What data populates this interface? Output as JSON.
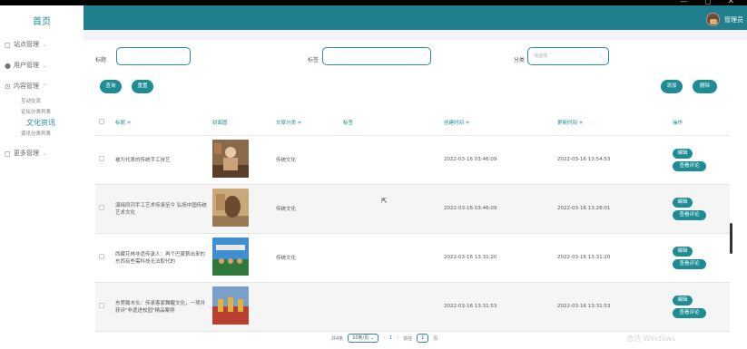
{
  "window": {
    "minimize": "—",
    "restore": "◻",
    "close": "✕"
  },
  "sidebar": {
    "home": "首页",
    "groups": [
      {
        "label": "站点管理",
        "icon": "calendar-icon"
      },
      {
        "label": "用户管理",
        "icon": "user-icon"
      },
      {
        "label": "内容管理",
        "icon": "settings-icon"
      },
      {
        "label": "更多管理",
        "icon": "document-icon"
      }
    ],
    "content_items": [
      "互动交流",
      "论坛分类列表",
      "文化资讯",
      "资讯分类列表"
    ],
    "active_item": "文化资讯"
  },
  "header": {
    "admin_label": "管理员"
  },
  "filters": {
    "title_label": "标题",
    "tags_label": "标签",
    "category_label": "分类",
    "category_placeholder": "请选择"
  },
  "buttons": {
    "search": "查询",
    "reset": "重置",
    "add": "添加",
    "delete": "删除"
  },
  "table": {
    "columns": [
      "标题 ≑",
      "封面图",
      "文章分类 ≑",
      "标签",
      "创建时间 ≑",
      "更新时间 ≑",
      "操作"
    ],
    "rows": [
      {
        "title": "被为代表的传统手工技艺",
        "category": "传统文化",
        "tags": "",
        "created": "2022-03-16 03:46:09",
        "updated": "2022-03-16 13:54:53"
      },
      {
        "title": "演绎同河手工艺术传承至今 弘扬中国传统艺术文化",
        "category": "传统文化",
        "tags": "",
        "created": "2022-03-16 03:46:09",
        "updated": "2022-03-16 13:28:01"
      },
      {
        "title": "西藏花林非遗传承人：再个巴蒙薪出来的东西有些需科技无法取代的",
        "category": "传统文化",
        "tags": "",
        "created": "2022-03-16 13:31:20",
        "updated": "2022-03-16 13:31:20"
      },
      {
        "title": "东莞稳木头：传承客家舞醒文化，一项并获评\"非遗进校园\"精品案例",
        "category": "",
        "tags": "",
        "created": "2022-03-16 13:31:53",
        "updated": "2022-03-16 13:31:53"
      }
    ],
    "edit_label": "编辑",
    "review_label": "查看评论"
  },
  "pagination": {
    "total": "共4条",
    "page_size": "10条/页",
    "prev": "‹",
    "current": "1",
    "next": "›",
    "goto_label": "前往",
    "goto_value": "1",
    "page_suffix": "页"
  },
  "watermark": "激活 Windows",
  "colors": {
    "accent": "#1f8c94",
    "header": "#1f7f8c"
  }
}
